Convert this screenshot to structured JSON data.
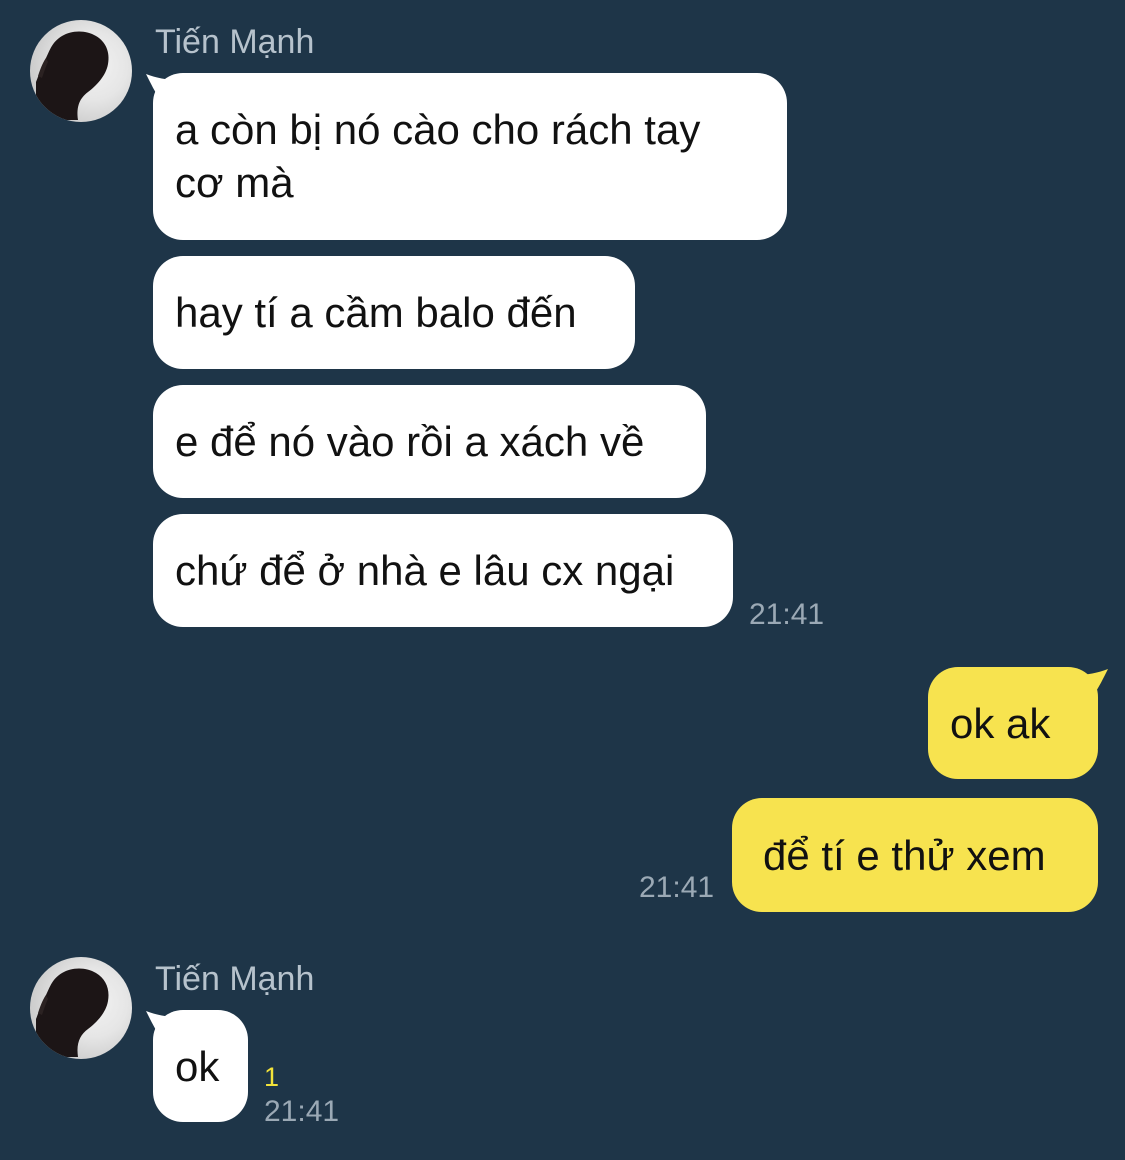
{
  "chat": {
    "groups": [
      {
        "sender": "Tiến Mạnh",
        "avatar_icon": "profile-photo-silhouette",
        "messages": [
          "a còn bị nó cào cho rách tay\ncơ mà",
          "hay tí a cầm balo đến",
          "e để nó vào rồi a xách về",
          "chứ để ở nhà e lâu cx ngại"
        ],
        "time": "21:41"
      },
      {
        "sender": "me",
        "messages": [
          "ok ak",
          "để tí e thử xem"
        ],
        "time": "21:41"
      },
      {
        "sender": "Tiến Mạnh",
        "avatar_icon": "profile-photo-silhouette",
        "messages": [
          "ok"
        ],
        "unread_count": "1",
        "time": "21:41"
      }
    ]
  },
  "colors": {
    "background": "#1e3548",
    "incoming_bubble": "#ffffff",
    "outgoing_bubble": "#f7e34f",
    "unread": "#f2e23a",
    "meta_text": "#9ba9b5"
  }
}
